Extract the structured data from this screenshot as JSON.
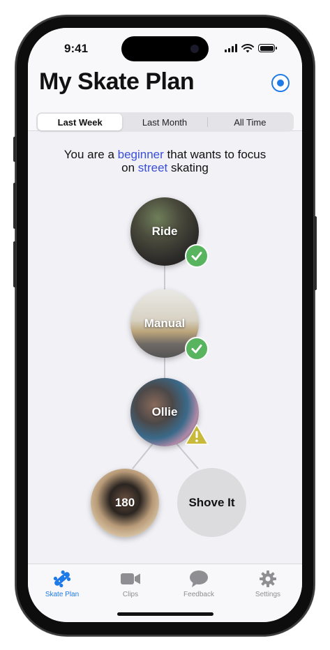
{
  "status_bar": {
    "time": "9:41"
  },
  "header": {
    "title": "My Skate Plan",
    "target_icon": "target-icon"
  },
  "segments": [
    {
      "label": "Last Week",
      "selected": true
    },
    {
      "label": "Last Month",
      "selected": false
    },
    {
      "label": "All Time",
      "selected": false
    }
  ],
  "headline": {
    "part1": "You are a ",
    "level": "beginner",
    "part2": " that wants to focus",
    "part3": "on ",
    "style": "street",
    "part4": " skating"
  },
  "skills": [
    {
      "label": "Ride",
      "status": "complete"
    },
    {
      "label": "Manual",
      "status": "complete"
    },
    {
      "label": "Ollie",
      "status": "warning"
    },
    {
      "label": "180",
      "status": "none"
    },
    {
      "label": "Shove It",
      "status": "locked"
    }
  ],
  "tabs": [
    {
      "label": "Skate Plan",
      "icon": "skateboard-icon",
      "active": true
    },
    {
      "label": "Clips",
      "icon": "video-camera-icon",
      "active": false
    },
    {
      "label": "Feedback",
      "icon": "speech-bubble-icon",
      "active": false
    },
    {
      "label": "Settings",
      "icon": "gear-icon",
      "active": false
    }
  ],
  "colors": {
    "accent": "#1e7ae6",
    "highlight": "#3a4fd9",
    "complete": "#58b45e",
    "warning": "#c9b93a"
  }
}
